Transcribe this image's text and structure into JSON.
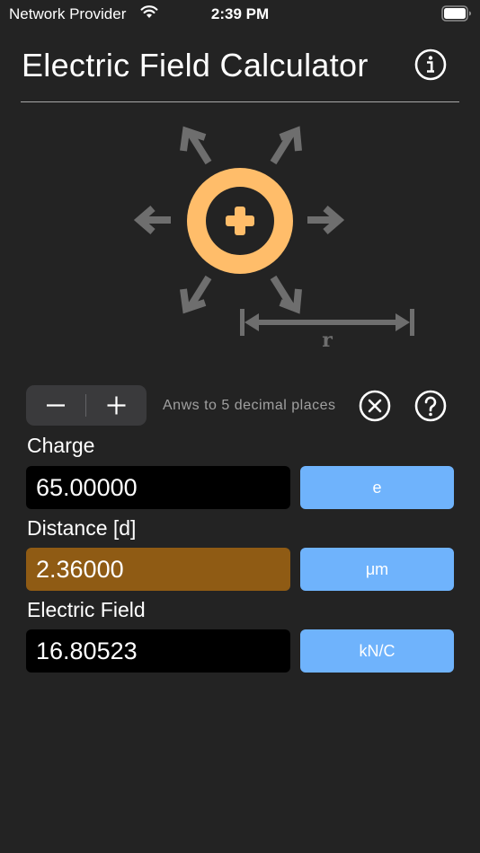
{
  "status": {
    "carrier": "Network Provider",
    "time": "2:39 PM"
  },
  "header": {
    "title": "Electric Field Calculator"
  },
  "diagram": {
    "distance_label": "r"
  },
  "controls": {
    "precision_text": "Anws to 5 decimal places"
  },
  "fields": [
    {
      "label": "Charge",
      "value": "65.00000",
      "unit": "e"
    },
    {
      "label": "Distance [d]",
      "value": "2.36000",
      "unit": "μm"
    },
    {
      "label": "Electric Field",
      "value": "16.80523",
      "unit": "kN/C"
    }
  ],
  "colors": {
    "background": "#232323",
    "charge_accent": "#FFBD6A",
    "active_field": "#8F5B14",
    "unit_button": "#6FB3FC",
    "arrow_gray": "#6E6E6E"
  }
}
